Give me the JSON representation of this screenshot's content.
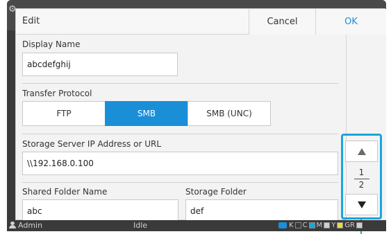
{
  "background": {
    "corner_text": "y."
  },
  "dialog": {
    "title": "Edit",
    "cancel_label": "Cancel",
    "ok_label": "OK"
  },
  "form": {
    "display_name": {
      "label": "Display Name",
      "value": "abcdefghij"
    },
    "transfer_protocol": {
      "label": "Transfer Protocol",
      "options": [
        "FTP",
        "SMB",
        "SMB (UNC)"
      ],
      "selected": "SMB"
    },
    "server": {
      "label": "Storage Server IP Address or URL",
      "value": "\\\\192.168.0.100"
    },
    "shared_folder": {
      "label": "Shared Folder Name",
      "value": "abc"
    },
    "storage_folder": {
      "label": "Storage Folder",
      "value": "def"
    }
  },
  "pager": {
    "up_icon": "up-arrow-icon",
    "down_icon": "down-arrow-icon",
    "current": "1",
    "total": "2"
  },
  "status_bar": {
    "user": "Admin",
    "state": "Idle",
    "ink": [
      {
        "label": "K",
        "color": "#3a3a3a"
      },
      {
        "label": "C",
        "color": "#1aa6dd"
      },
      {
        "label": "M",
        "color": "#d0d0d0"
      },
      {
        "label": "Y",
        "color": "#e8d84a"
      },
      {
        "label": "GR",
        "color": "#d0d0d0"
      }
    ]
  },
  "colors": {
    "accent": "#1a8fd8",
    "highlight": "#1aa6dd"
  }
}
